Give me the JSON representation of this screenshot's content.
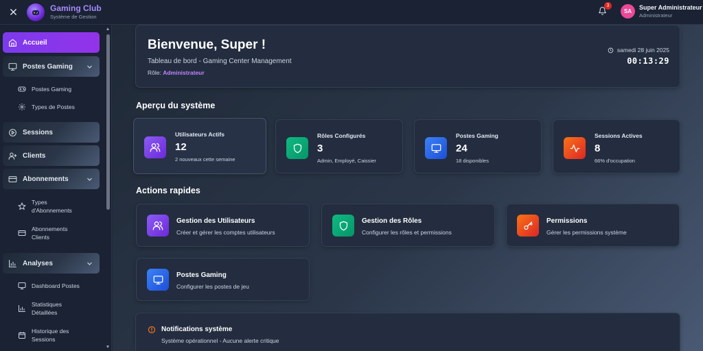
{
  "app": {
    "title": "Gaming Club",
    "subtitle": "Système de Gestion"
  },
  "header": {
    "notification_count": "3",
    "user_initials": "SA",
    "user_name": "Super Administrateur",
    "user_role": "Administrateur"
  },
  "sidebar": {
    "items": [
      {
        "label": "Accueil",
        "icon": "home-icon",
        "active": true
      },
      {
        "label": "Postes Gaming",
        "icon": "monitor-icon",
        "expandable": true
      },
      {
        "label": "Postes Gaming",
        "icon": "gamepad-icon",
        "sub": true
      },
      {
        "label": "Types de Postes",
        "icon": "gear-icon",
        "sub": true
      },
      {
        "label": "Sessions",
        "icon": "play-circle-icon"
      },
      {
        "label": "Clients",
        "icon": "user-plus-icon"
      },
      {
        "label": "Abonnements",
        "icon": "card-icon",
        "expandable": true
      },
      {
        "label": "Types d'Abonnements",
        "icon": "star-icon",
        "sub": true
      },
      {
        "label": "Abonnements Clients",
        "icon": "card-icon",
        "sub": true
      },
      {
        "label": "Analyses",
        "icon": "bar-chart-icon",
        "expandable": true
      },
      {
        "label": "Dashboard Postes",
        "icon": "monitor-icon",
        "sub": true
      },
      {
        "label": "Statistiques Détaillées",
        "icon": "bar-chart-icon",
        "sub": true
      },
      {
        "label": "Historique des Sessions",
        "icon": "calendar-icon",
        "sub": true
      }
    ]
  },
  "welcome": {
    "title": "Bienvenue, Super !",
    "subtitle": "Tableau de bord - Gaming Center Management",
    "role_label": "Rôle:",
    "role_value": "Administrateur",
    "date": "samedi 28 juin 2025",
    "time": "00:13:29"
  },
  "overview": {
    "title": "Aperçu du système",
    "stats": [
      {
        "label": "Utilisateurs Actifs",
        "value": "12",
        "note": "2 nouveaux cette semaine",
        "icon": "users-icon",
        "color": "#8b5cf6"
      },
      {
        "label": "Rôles Configurés",
        "value": "3",
        "note": "Admin, Employé, Caissier",
        "icon": "shield-icon",
        "color": "#10b981"
      },
      {
        "label": "Postes Gaming",
        "value": "24",
        "note": "18 disponibles",
        "icon": "monitor-icon",
        "color": "#3b82f6"
      },
      {
        "label": "Sessions Actives",
        "value": "8",
        "note": "66% d'occupation",
        "icon": "activity-icon",
        "color": "#ef4444"
      }
    ]
  },
  "quick_actions": {
    "title": "Actions rapides",
    "items": [
      {
        "title": "Gestion des Utilisateurs",
        "desc": "Créer et gérer les comptes utilisateurs",
        "icon": "users-icon",
        "color": "#8b5cf6"
      },
      {
        "title": "Gestion des Rôles",
        "desc": "Configurer les rôles et permissions",
        "icon": "shield-icon",
        "color": "#10b981"
      },
      {
        "title": "Permissions",
        "desc": "Gérer les permissions système",
        "icon": "key-icon",
        "color": "#ef4444"
      },
      {
        "title": "Postes Gaming",
        "desc": "Configurer les postes de jeu",
        "icon": "monitor-icon",
        "color": "#3b82f6"
      }
    ]
  },
  "notifications": {
    "title": "Notifications système",
    "message": "Système opérationnel - Aucune alerte critique"
  }
}
